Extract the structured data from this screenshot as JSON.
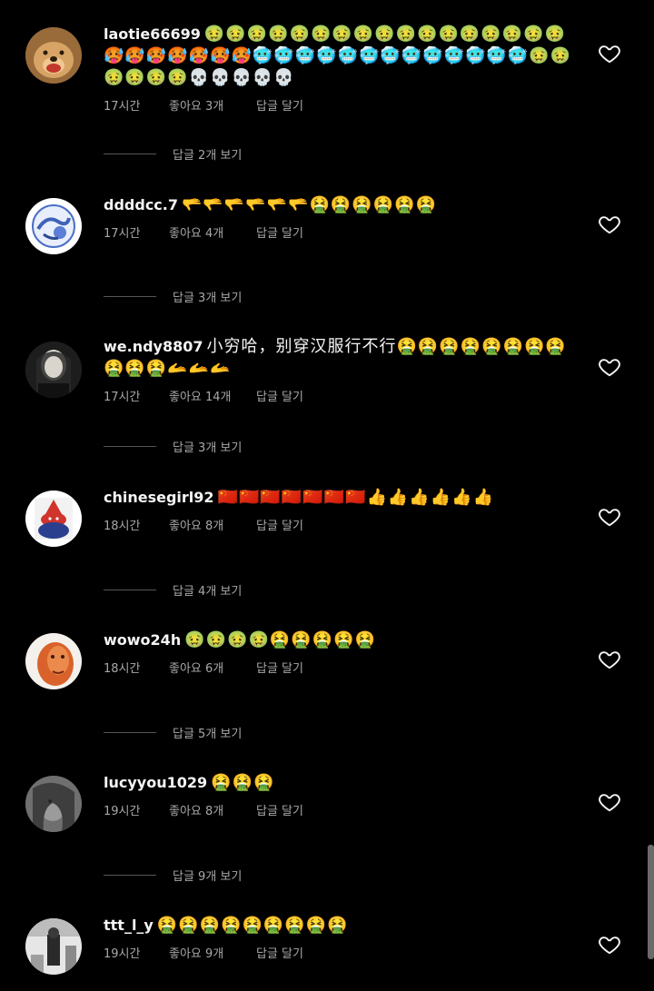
{
  "comments": [
    {
      "username": "laotie66699",
      "text": "🤢🤢🤢🤢🤢🤢🤢🤢🤢🤢🤢🤢🤢🤢🤢🤢🤢🥵🥵🥵🥵🥵🥵🥵🥶🥶🥶🥶🥶🥶🥶🥶🥶🥶🥶🥶🥶🤢🤢🤢🤢🤢🤢💀💀💀💀💀",
      "time": "17시간",
      "likes": "좋아요 3개",
      "reply": "답글 달기",
      "view_replies": "답글 2개 보기",
      "avatar": "golden-dog"
    },
    {
      "username": "ddddcc.7",
      "text": "🫳🫳🫳🫳🫳🫳🤮🤮🤮🤮🤮🤮",
      "time": "17시간",
      "likes": "좋아요 4개",
      "reply": "답글 달기",
      "view_replies": "답글 3개 보기",
      "avatar": "blue-emblem"
    },
    {
      "username": "we.ndy8807",
      "text": "小穷哈，别穿汉服行不行🤮🤮🤮🤮🤮🤮🤮🤮🤮🤮🤮🫴🫴🫴",
      "time": "17시간",
      "likes": "좋아요 14개",
      "reply": "답글 달기",
      "view_replies": "답글 3개 보기",
      "avatar": "portrait-dark"
    },
    {
      "username": "chinesegirl92",
      "text": "🇨🇳🇨🇳🇨🇳🇨🇳🇨🇳🇨🇳🇨🇳👍👍👍👍👍👍",
      "time": "18시간",
      "likes": "좋아요 8개",
      "reply": "답글 달기",
      "view_replies": "답글 4개 보기",
      "avatar": "red-blue-figure"
    },
    {
      "username": "wowo24h",
      "text": "🤢🤢🤢🤢🤮🤮🤮🤮🤮",
      "time": "18시간",
      "likes": "좋아요 6개",
      "reply": "답글 달기",
      "view_replies": "답글 5개 보기",
      "avatar": "face-orange"
    },
    {
      "username": "lucyyou1029",
      "text": "🤮🤮🤮",
      "time": "19시간",
      "likes": "좋아요 8개",
      "reply": "답글 달기",
      "view_replies": "답글 9개 보기",
      "avatar": "gray-portrait"
    },
    {
      "username": "ttt_l_y",
      "text": "🤮🤮🤮🤮🤮🤮🤮🤮🤮",
      "time": "19시간",
      "likes": "좋아요 9개",
      "reply": "답글 달기",
      "view_replies": "",
      "avatar": "bw-room"
    }
  ]
}
